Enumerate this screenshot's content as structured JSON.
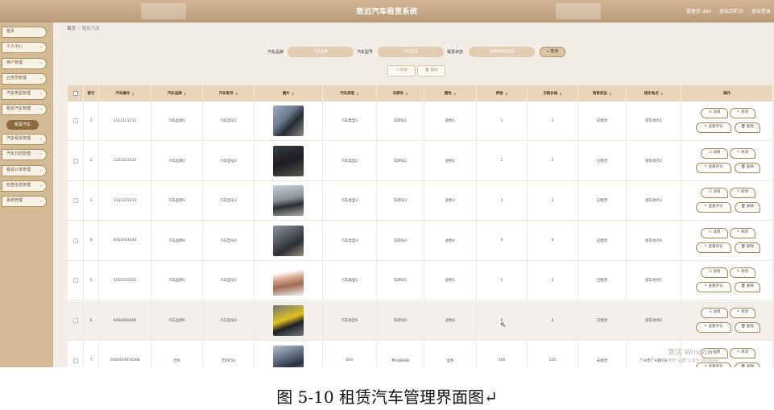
{
  "app": {
    "title": "致远汽车租赁系统",
    "top_links": [
      "管理员 abo",
      "退出到前台",
      "退出登录"
    ]
  },
  "sidebar": {
    "items": [
      {
        "label": "首页",
        "chevron": false
      },
      {
        "label": "个人中心",
        "chevron": true
      },
      {
        "label": "用户管理",
        "chevron": true
      },
      {
        "label": "业务员管理",
        "chevron": true
      },
      {
        "label": "汽车类型管理",
        "chevron": true
      },
      {
        "label": "租赁汽车管理",
        "chevron": true
      },
      {
        "label": "汽车租赁管理",
        "chevron": true
      },
      {
        "label": "汽车归还管理",
        "chevron": true
      },
      {
        "label": "租赁订单管理",
        "chevron": true
      },
      {
        "label": "检查信息管理",
        "chevron": true
      },
      {
        "label": "系统管理",
        "chevron": true
      }
    ],
    "active_sub": "租赁汽车"
  },
  "breadcrumb": {
    "home": "首页",
    "sep": "/",
    "current": "租赁汽车"
  },
  "search": {
    "brand_label": "汽车品牌",
    "brand_placeholder": "汽车品牌",
    "model_label": "汽车型号",
    "model_placeholder": "汽车型号",
    "status_label": "租赁状态",
    "status_placeholder": "请选择租赁状态",
    "query_label": "查询"
  },
  "actions": {
    "add_label": "+ 新增",
    "delete_label": "删除"
  },
  "table": {
    "columns": [
      "索引",
      "汽车编号",
      "汽车品牌",
      "汽车型号",
      "图片",
      "汽车类型",
      "车牌号",
      "颜色",
      "押金",
      "日租价格",
      "租赁状态",
      "提车地点",
      "操作"
    ],
    "rows": [
      {
        "index": "1",
        "car_no": "1111111111",
        "brand": "汽车品牌1",
        "model": "汽车型号1",
        "type": "汽车类型1",
        "plate": "车牌号1",
        "color": "颜色1",
        "deposit": "1",
        "daily": "1",
        "status": "已租赁",
        "location": "提车地点1"
      },
      {
        "index": "2",
        "car_no": "2222222222",
        "brand": "汽车品牌2",
        "model": "汽车型号2",
        "type": "汽车类型2",
        "plate": "车牌号2",
        "color": "颜色2",
        "deposit": "2",
        "daily": "2",
        "status": "已租赁",
        "location": "提车地点2"
      },
      {
        "index": "3",
        "car_no": "3333333333",
        "brand": "汽车品牌3",
        "model": "汽车型号3",
        "type": "汽车类型3",
        "plate": "车牌号3",
        "color": "颜色3",
        "deposit": "3",
        "daily": "3",
        "status": "已租赁",
        "location": "提车地点3"
      },
      {
        "index": "4",
        "car_no": "4444444444",
        "brand": "汽车品牌4",
        "model": "汽车型号4",
        "type": "汽车类型4",
        "plate": "车牌号4",
        "color": "颜色4",
        "deposit": "4",
        "daily": "4",
        "status": "已租赁",
        "location": "提车地点4"
      },
      {
        "index": "5",
        "car_no": "5555555555",
        "brand": "汽车品牌5",
        "model": "汽车型号5",
        "type": "汽车类型5",
        "plate": "车牌号5",
        "color": "颜色5",
        "deposit": "5",
        "daily": "5",
        "status": "已租赁",
        "location": "提车地点5"
      },
      {
        "index": "6",
        "car_no": "6666666666",
        "brand": "汽车品牌6",
        "model": "汽车型号6",
        "type": "汽车类型6",
        "plate": "车牌号6",
        "color": "颜色6",
        "deposit": "6",
        "daily": "6",
        "status": "已租赁",
        "location": "提车地点6"
      },
      {
        "index": "7",
        "car_no": "1644919954308",
        "brand": "吉利",
        "model": "吉利E50",
        "type": "SUV",
        "plate": "粤A88888",
        "color": "蓝色",
        "deposit": "500",
        "daily": "220",
        "status": "未租赁",
        "location": "广州市广州路2号"
      }
    ],
    "row_ops": {
      "detail": "详情",
      "edit": "修改",
      "review": "查看评论",
      "delete": "删除"
    }
  },
  "watermark": {
    "line1": "激活 Windows",
    "line2": "转到\"设置\"以激活 Windows。"
  },
  "caption": "图 5-10 租赁汽车管理界面图↵",
  "colors": {
    "accent": "#b08d55",
    "header": "#e8d5bc",
    "topbar": "#c8a886"
  }
}
